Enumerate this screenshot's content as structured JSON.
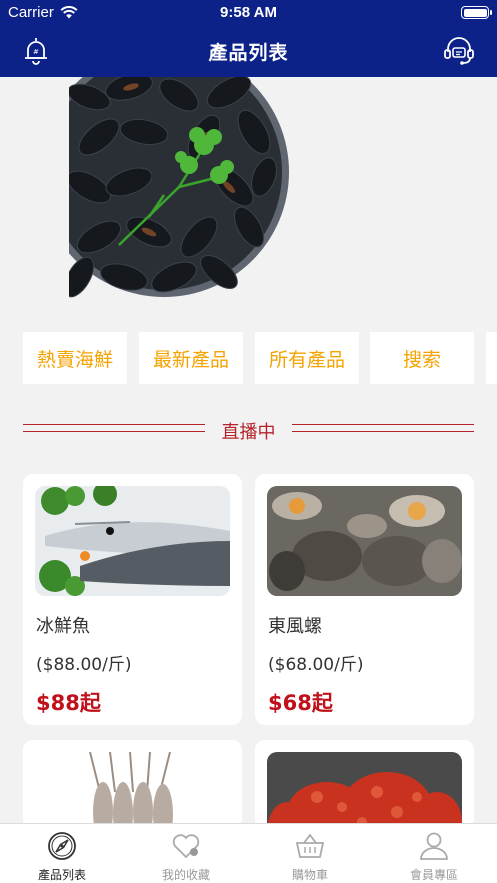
{
  "status_bar": {
    "carrier": "Carrier",
    "time": "9:58 AM"
  },
  "header": {
    "title": "產品列表",
    "left_icon": "notification-bell-icon",
    "right_icon": "customer-service-icon"
  },
  "categories": [
    "熱賣海鮮",
    "最新產品",
    "所有產品",
    "搜索"
  ],
  "section": {
    "live_label": "直播中"
  },
  "products": [
    {
      "name": "冰鮮魚",
      "unit_price": "($88.00/斤)",
      "price": "$88起"
    },
    {
      "name": "東風螺",
      "unit_price": "($68.00/斤)",
      "price": "$68起"
    }
  ],
  "tabbar": [
    {
      "label": "產品列表",
      "icon": "compass-icon",
      "active": true
    },
    {
      "label": "我的收藏",
      "icon": "heart-icon",
      "active": false
    },
    {
      "label": "購物車",
      "icon": "basket-icon",
      "active": false
    },
    {
      "label": "會員專區",
      "icon": "user-icon",
      "active": false
    }
  ],
  "colors": {
    "nav": "#0d2288",
    "category_text": "#f5a300",
    "accent_red": "#c0101a",
    "divider": "#b4232a"
  }
}
